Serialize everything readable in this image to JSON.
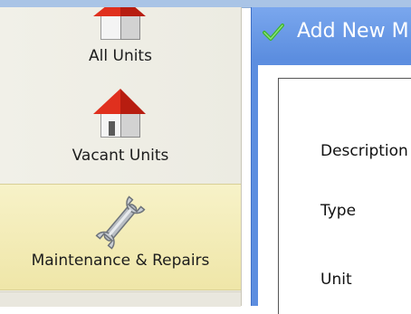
{
  "sidebar": {
    "items": [
      {
        "label": "All Units",
        "icon": "house-icon"
      },
      {
        "label": "Vacant Units",
        "icon": "house-icon"
      },
      {
        "label": "Maintenance & Repairs",
        "icon": "wrench-icon",
        "selected": true
      }
    ]
  },
  "dialog": {
    "title": "Add New M",
    "icon": "checkmark-icon",
    "fields": [
      {
        "label": "Description"
      },
      {
        "label": "Type"
      },
      {
        "label": "Unit"
      }
    ]
  },
  "colors": {
    "dialog_header": "#6d9be8",
    "selected_item": "#f3eab8",
    "roof": "#e0301e"
  }
}
